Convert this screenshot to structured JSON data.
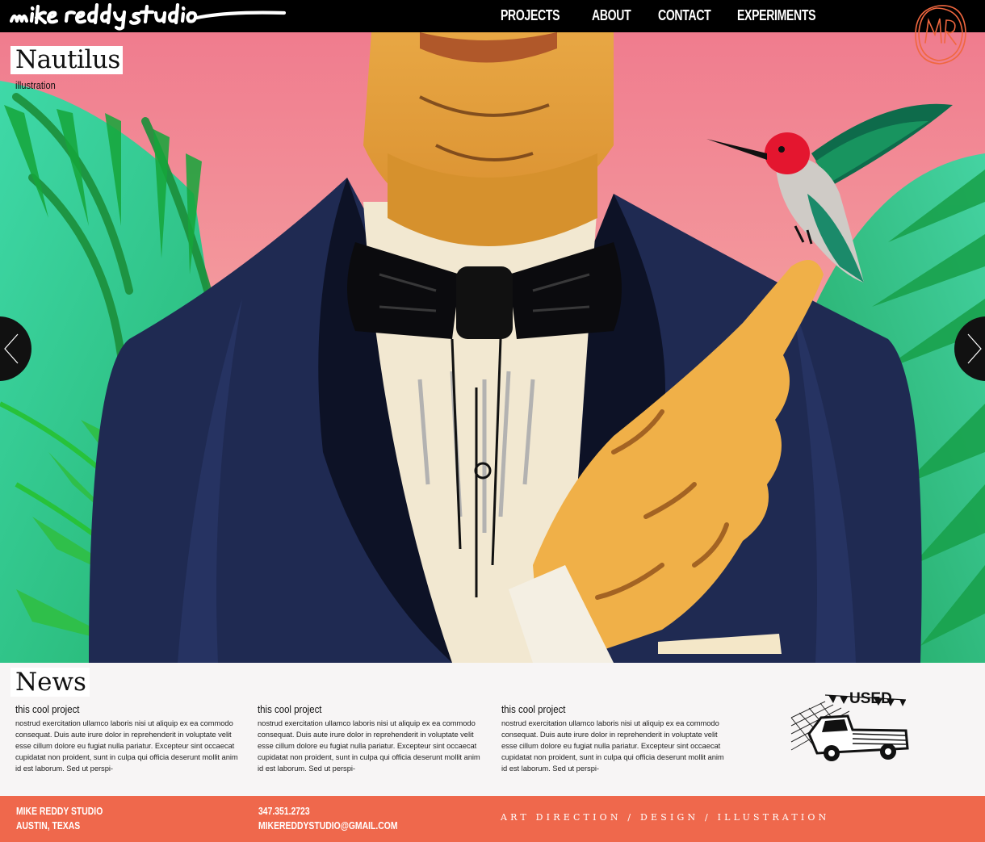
{
  "site": {
    "logo_text": "mike reddy studio",
    "monogram_text": "MR"
  },
  "nav": {
    "items": [
      {
        "label": "PROJECTS"
      },
      {
        "label": "ABOUT"
      },
      {
        "label": "CONTACT"
      },
      {
        "label": "EXPERIMENTS"
      }
    ]
  },
  "hero": {
    "project_title": "Nautilus",
    "project_category": "illustration"
  },
  "news": {
    "title": "News",
    "items": [
      {
        "heading": "this cool project",
        "body": "nostrud exercitation ullamco laboris nisi ut aliquip ex ea commodo consequat. Duis aute irure dolor in reprehenderit in voluptate velit esse cillum dolore eu fugiat nulla pariatur. Excepteur sint occaecat cupidatat non proident, sunt in culpa qui officia deserunt mollit anim id est laborum. Sed ut perspi-"
      },
      {
        "heading": "this cool project",
        "body": "nostrud exercitation ullamco laboris nisi ut aliquip ex ea commodo consequat. Duis aute irure dolor in reprehenderit in voluptate velit esse cillum dolore eu fugiat nulla pariatur. Excepteur sint occaecat cupidatat non proident, sunt in culpa qui officia deserunt mollit anim id est laborum. Sed ut perspi-"
      },
      {
        "heading": "this cool project",
        "body": "nostrud exercitation ullamco laboris nisi ut aliquip ex ea commodo consequat. Duis aute irure dolor in reprehenderit in voluptate velit esse cillum dolore eu fugiat nulla pariatur. Excepteur sint occaecat cupidatat non proident, sunt in culpa qui officia deserunt mollit anim id est laborum. Sed ut perspi-"
      }
    ],
    "badge_text": "USED"
  },
  "footer": {
    "studio_name": "MIKE REDDY STUDIO",
    "location": "AUSTIN, TEXAS",
    "phone": "347.351.2723",
    "email": "MIKEREDDYSTUDIO@GMAIL.COM",
    "tagline": "ART DIRECTION / DESIGN / ILLUSTRATION"
  },
  "colors": {
    "topbar": "#000000",
    "footer_accent": "#ef684c",
    "monogram_accent": "#f0673f",
    "hero_sky": "#f3858c"
  },
  "icons": {
    "prev": "chevron-left-icon",
    "next": "chevron-right-icon"
  }
}
